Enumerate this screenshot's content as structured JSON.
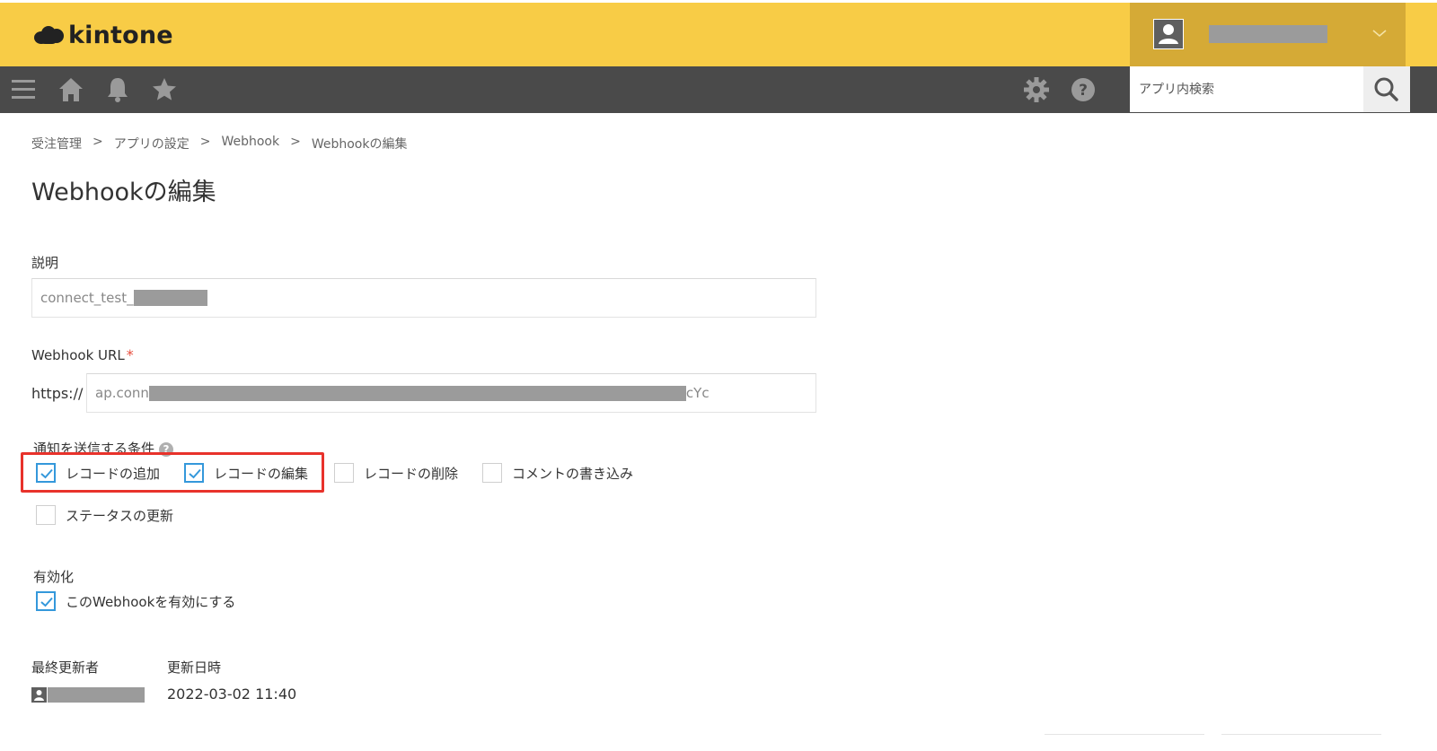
{
  "app": {
    "logo_text": "kintone",
    "brand_color": "#f8cc46",
    "toolbar_color": "#4a4a4a"
  },
  "toolbar": {
    "icons": [
      "menu-icon",
      "home-icon",
      "bell-icon",
      "star-icon",
      "gear-icon",
      "help-icon",
      "search-icon"
    ],
    "search_placeholder": "アプリ内検索"
  },
  "breadcrumb": {
    "items": [
      "受注管理",
      "アプリの設定",
      "Webhook",
      "Webhookの編集"
    ],
    "separator": ">"
  },
  "page": {
    "title": "Webhookの編集"
  },
  "form": {
    "description": {
      "label": "説明",
      "value": "connect_test_"
    },
    "webhook_url": {
      "label": "Webhook URL",
      "required_mark": "*",
      "prefix": "https://",
      "value_start": "ap.conn",
      "value_end": "cYc"
    },
    "conditions": {
      "label": "通知を送信する条件",
      "help": "?",
      "options": [
        {
          "label": "レコードの追加",
          "checked": true
        },
        {
          "label": "レコードの編集",
          "checked": true
        },
        {
          "label": "レコードの削除",
          "checked": false
        },
        {
          "label": "コメントの書き込み",
          "checked": false
        },
        {
          "label": "ステータスの更新",
          "checked": false
        }
      ]
    },
    "activation": {
      "label": "有効化",
      "option": {
        "label": "このWebhookを有効にする",
        "checked": true
      }
    }
  },
  "meta": {
    "updated_by_label": "最終更新者",
    "updated_at_label": "更新日時",
    "updated_at_value": "2022-03-02 11:40"
  },
  "colors": {
    "check_accent": "#3498db",
    "highlight": "#e8322b"
  }
}
